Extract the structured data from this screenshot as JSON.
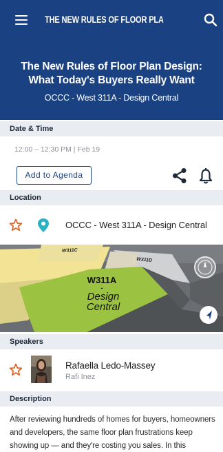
{
  "appbar": {
    "title": "THE NEW RULES OF FLOOR PLAN DESIGN:...",
    "menu_icon": "hamburger-menu-icon",
    "search_icon": "search-icon"
  },
  "hero": {
    "title": "The New Rules of Floor Plan Design: What Today's Buyers Really Want",
    "location": "OCCC - West 311A - Design Central"
  },
  "sections": {
    "date_time": "Date & Time",
    "location": "Location",
    "speakers": "Speakers",
    "description": "Description"
  },
  "date_time": {
    "value": "12:00 – 12:30 PM | Feb 19"
  },
  "actions": {
    "add_to_agenda": "Add to Agenda",
    "share_icon": "share-icon",
    "bell_icon": "bell-icon"
  },
  "location": {
    "name": "OCCC - West 311A - Design Central",
    "star_icon": "star-outline-icon",
    "pin_icon": "map-pin-icon"
  },
  "map": {
    "room_label_1": "W311A",
    "room_label_2": "-",
    "room_label_3": "Design",
    "room_label_4": "Central",
    "adjacent_1": "W311C",
    "adjacent_2": "W311D",
    "compass_icon": "compass-icon",
    "locate_icon": "navigation-arrow-icon"
  },
  "speaker": {
    "name": "Rafaella Ledo-Massey",
    "org": "Rafi Inez"
  },
  "description": "After reviewing hundreds of homes for buyers, homeowners and developers, the same floor plan frustrations keep showing up — and they're costing you sales. In this",
  "colors": {
    "brand_blue": "#1a4181",
    "accent_orange": "#e0672a",
    "pin_teal": "#2ab3c4",
    "highlight_green": "#9cc241"
  }
}
